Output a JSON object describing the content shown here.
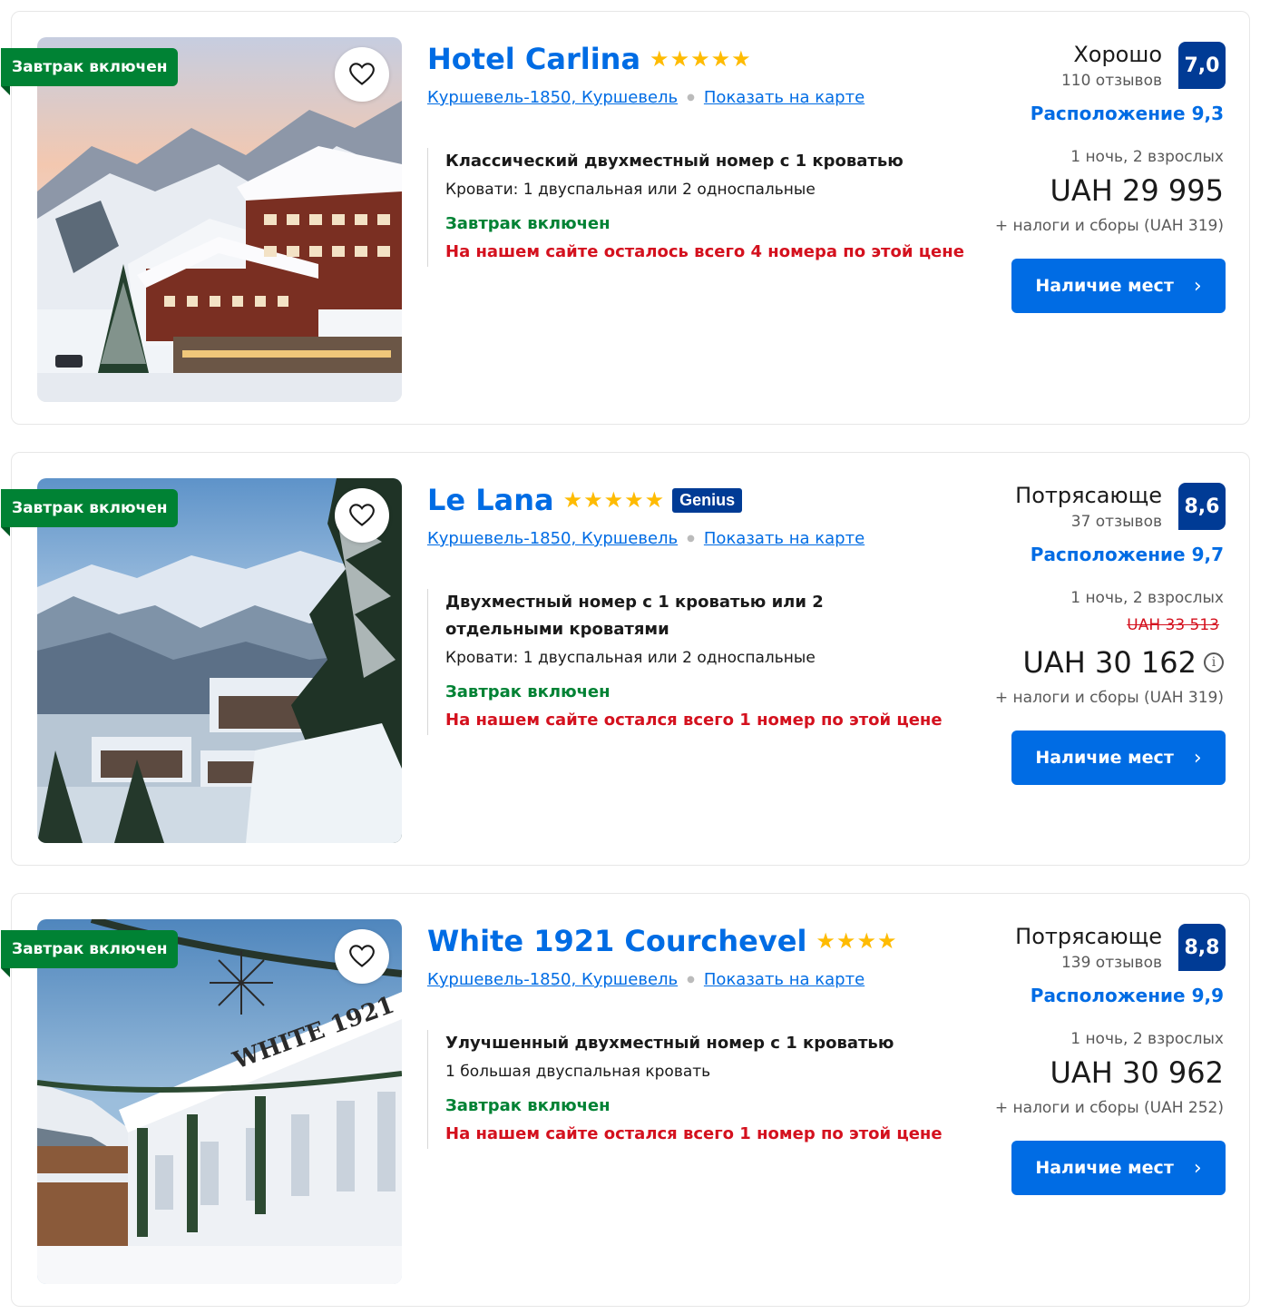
{
  "hotels": [
    {
      "ribbon": "Завтрак включен",
      "name": "Hotel Carlina",
      "stars": "★★★★★",
      "genius": "",
      "location": "Куршевель-1850, Куршевель",
      "map_link": "Показать на карте",
      "verdict": "Хорошо",
      "reviews": "110 отзывов",
      "score": "7,0",
      "location_score": "Расположение 9,3",
      "room_name": "Классический двухместный номер с 1 кроватью",
      "room_beds": "Кровати: 1 двуспальная или 2 односпальные",
      "breakfast": "Завтрак включен",
      "rooms_left": "На нашем сайте осталось всего 4 номера по этой цене",
      "nights": "1 ночь, 2 взрослых",
      "old_price": "",
      "price": "UAH 29 995",
      "taxes": "+ налоги и сборы (UAH 319)",
      "button": "Наличие мест"
    },
    {
      "ribbon": "Завтрак включен",
      "name": "Le Lana",
      "stars": "★★★★★",
      "genius": "Genius",
      "location": "Куршевель-1850, Куршевель",
      "map_link": "Показать на карте",
      "verdict": "Потрясающе",
      "reviews": "37 отзывов",
      "score": "8,6",
      "location_score": "Расположение 9,7",
      "room_name": "Двухместный номер с 1 кроватью или 2 отдельными кроватями",
      "room_beds": "Кровати: 1 двуспальная или 2 односпальные",
      "breakfast": "Завтрак включен",
      "rooms_left": "На нашем сайте остался всего 1 номер по этой цене",
      "nights": "1 ночь, 2 взрослых",
      "old_price": "UAH 33 513",
      "price": "UAH 30 162",
      "taxes": "+ налоги и сборы (UAH 319)",
      "button": "Наличие мест"
    },
    {
      "ribbon": "Завтрак включен",
      "name": "White 1921 Courchevel",
      "stars": "★★★★",
      "genius": "",
      "location": "Куршевель-1850, Куршевель",
      "map_link": "Показать на карте",
      "verdict": "Потрясающе",
      "reviews": "139 отзывов",
      "score": "8,8",
      "location_score": "Расположение 9,9",
      "room_name": "Улучшенный двухместный номер с 1 кроватью",
      "room_beds": "1 большая двуспальная кровать",
      "breakfast": "Завтрак включен",
      "rooms_left": "На нашем сайте остался всего 1 номер по этой цене",
      "nights": "1 ночь, 2 взрослых",
      "old_price": "",
      "price": "UAH 30 962",
      "taxes": "+ налоги и сборы (UAH 252)",
      "button": "Наличие мест"
    }
  ],
  "colors": {
    "brand_blue": "#006ce4",
    "score_blue": "#003b95",
    "breakfast_green": "#008234",
    "alert_red": "#d4111e",
    "star_yellow": "#febb02"
  },
  "icons": [
    "heart-icon",
    "chevron-right-icon",
    "info-icon",
    "star-icon"
  ],
  "photo_text": "WHITE 1921"
}
